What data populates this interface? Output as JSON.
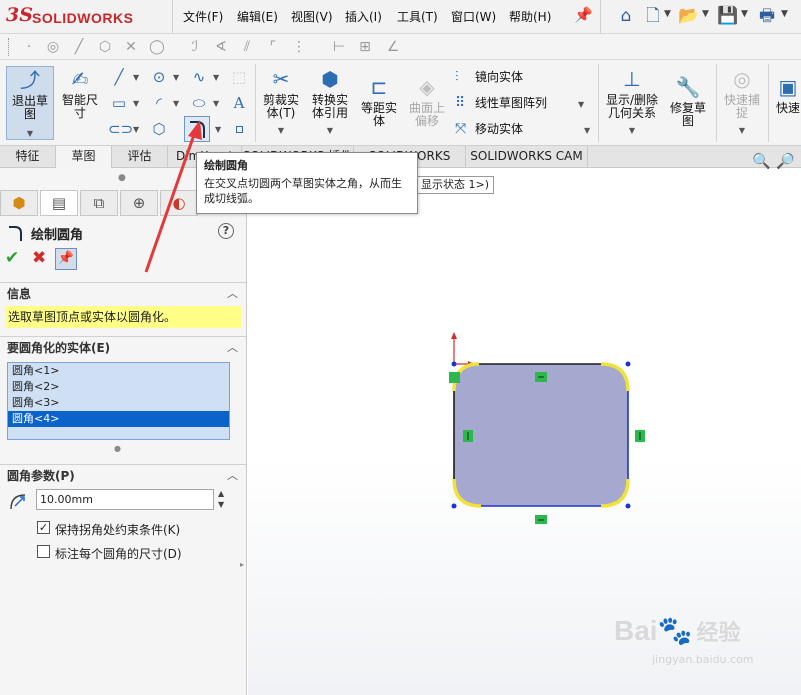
{
  "app": {
    "logo_ds": "3S",
    "logo_text": "SOLIDWORKS"
  },
  "menu": [
    "文件(F)",
    "编辑(E)",
    "视图(V)",
    "插入(I)",
    "工具(T)",
    "窗口(W)",
    "帮助(H)"
  ],
  "ribbon": {
    "exit_sketch": "退出草\n图",
    "smart_dim": "智能尺\n寸",
    "trim": "剪裁实\n体(T)",
    "convert": "转换实\n体引用",
    "offset": "等距实\n体",
    "surface_offset": "曲面上\n偏移",
    "mirror": "镜向实体",
    "linear_pattern": "线性草图阵列",
    "move": "移动实体",
    "display_delete": "显示/删除\n几何关系",
    "repair": "修复草\n图",
    "quick_snap": "快速捕\n捉",
    "quick_view": "快速"
  },
  "tabs": [
    "特征",
    "草图",
    "评估",
    "DimXpert",
    "SOLIDWORKS 插件",
    "SOLIDWORKS MBD",
    "SOLIDWORKS CAM"
  ],
  "tooltip": {
    "title": "绘制圆角",
    "body": "在交叉点切圆两个草图实体之角，从而生成切线弧。"
  },
  "canvas_breadcrumb": "显示状态 1>)",
  "panel": {
    "title": "绘制圆角",
    "help": "?",
    "info_header": "信息",
    "info_text": "选取草图顶点或实体以圆角化。",
    "entities_header": "要圆角化的实体(E)",
    "entities": [
      "圆角<1>",
      "圆角<2>",
      "圆角<3>",
      "圆角<4>"
    ],
    "selected_entity_index": 3,
    "params_header": "圆角参数(P)",
    "radius_value": "10.00mm",
    "keep_constraints_label": "保持拐角处约束条件(K)",
    "keep_constraints_checked": true,
    "dimension_each_label": "标注每个圆角的尺寸(D)",
    "dimension_each_checked": false
  },
  "watermark": {
    "brand": "Bai",
    "brand2": "经验",
    "url": "jingyan.baidu.com"
  },
  "colors": {
    "accent_blue": "#0a63c9",
    "sketch_fill": "#a6a9cf",
    "fillet_yellow": "#f1e23a",
    "info_yellow": "#ffff88",
    "constraint_green": "#2db84b",
    "logo_red": "#c9262c"
  }
}
